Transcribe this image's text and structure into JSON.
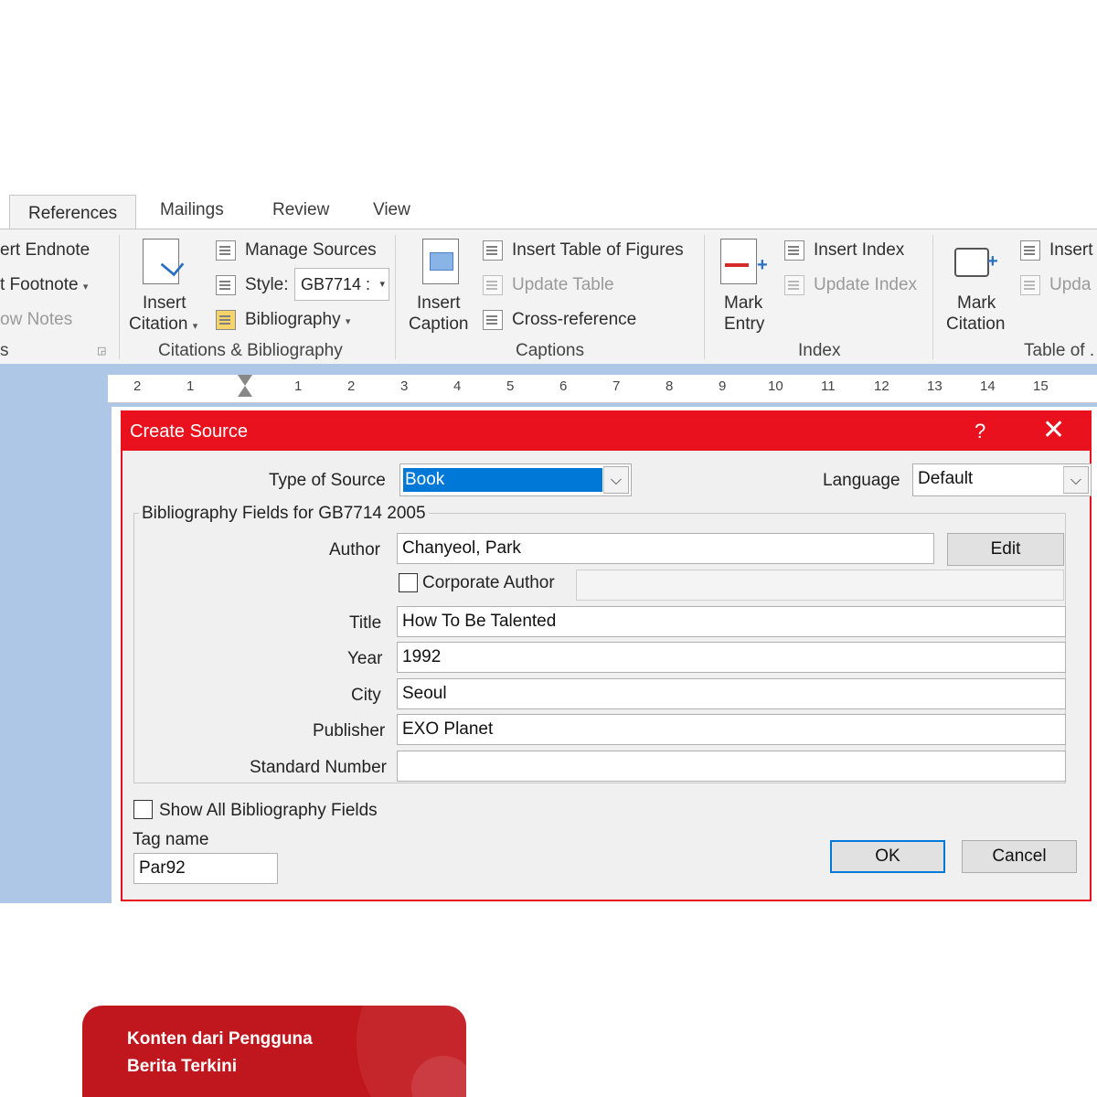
{
  "ribbon": {
    "tabs": [
      {
        "label": "References",
        "active": true
      },
      {
        "label": "Mailings",
        "active": false
      },
      {
        "label": "Review",
        "active": false
      },
      {
        "label": "View",
        "active": false
      }
    ],
    "footnotes": {
      "insert_endnote": "ert Endnote",
      "next_footnote": "t Footnote",
      "show_notes": "ow Notes",
      "group_label": "s"
    },
    "citations": {
      "insert_citation_line1": "Insert",
      "insert_citation_line2": "Citation",
      "manage_sources": "Manage Sources",
      "style_label": "Style:",
      "style_value": "GB7714 :",
      "bibliography": "Bibliography",
      "group_label": "Citations & Bibliography"
    },
    "captions": {
      "insert_caption_line1": "Insert",
      "insert_caption_line2": "Caption",
      "insert_table_of_figures": "Insert Table of Figures",
      "update_table": "Update Table",
      "cross_reference": "Cross-reference",
      "group_label": "Captions"
    },
    "index": {
      "mark_entry_line1": "Mark",
      "mark_entry_line2": "Entry",
      "insert_index": "Insert Index",
      "update_index": "Update Index",
      "group_label": "Index"
    },
    "table_of_authorities": {
      "mark_citation_line1": "Mark",
      "mark_citation_line2": "Citation",
      "insert": "Insert",
      "update": "Upda",
      "group_label": "Table of ."
    }
  },
  "ruler": {
    "numbers": [
      "2",
      "1",
      "1",
      "2",
      "3",
      "4",
      "5",
      "6",
      "7",
      "8",
      "9",
      "10",
      "11",
      "12",
      "13",
      "14",
      "15"
    ]
  },
  "dialog": {
    "title": "Create Source",
    "help": "?",
    "close": "✕",
    "type_of_source_label": "Type of Source",
    "type_of_source_value": "Book",
    "language_label": "Language",
    "language_value": "Default",
    "group_title": "Bibliography Fields for GB7714 2005",
    "fields": {
      "author_label": "Author",
      "author_value": "Chanyeol, Park",
      "edit_button": "Edit",
      "corporate_author_label": "Corporate Author",
      "corporate_author_value": "",
      "title_label": "Title",
      "title_value": "How To Be Talented",
      "year_label": "Year",
      "year_value": "1992",
      "city_label": "City",
      "city_value": "Seoul",
      "publisher_label": "Publisher",
      "publisher_value": "EXO Planet",
      "standard_number_label": "Standard Number",
      "standard_number_value": ""
    },
    "show_all_label": "Show All Bibliography Fields",
    "tag_name_label": "Tag name",
    "tag_name_value": "Par92",
    "ok_button": "OK",
    "cancel_button": "Cancel"
  },
  "badge": {
    "line1": "Konten dari Pengguna",
    "line2": "Berita Terkini"
  },
  "colors": {
    "dialog_accent": "#e8111d",
    "selection": "#0078d7",
    "badge": "#c0161d"
  }
}
